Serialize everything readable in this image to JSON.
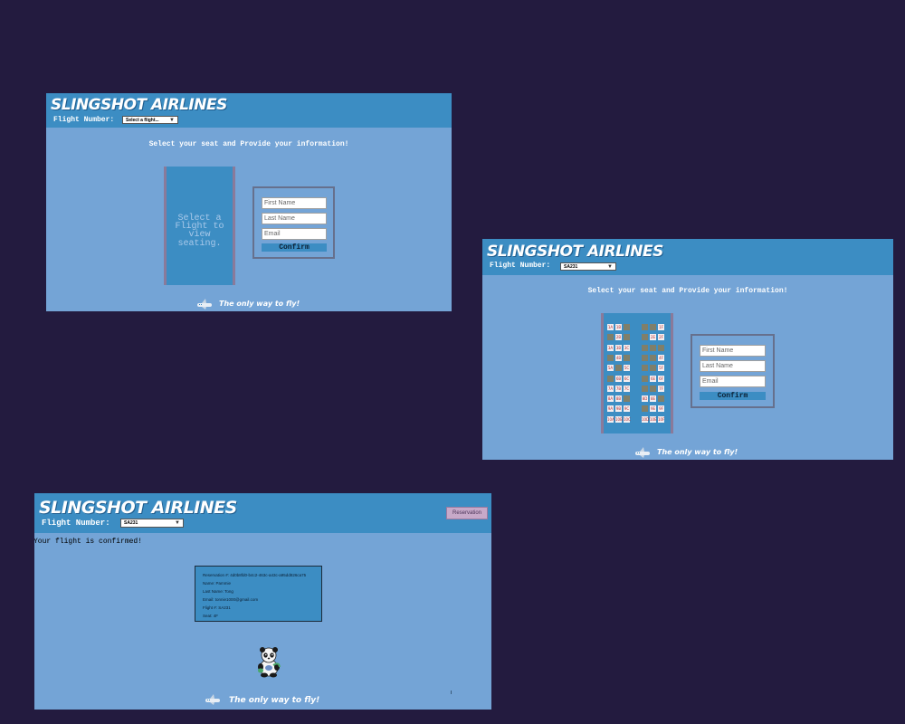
{
  "brand": "SLINGSHOT AIRLINES",
  "flight_label": "Flight Number:",
  "tagline": "The only way to fly!",
  "heading": "Select your seat and Provide your information!",
  "form": {
    "first_name_placeholder": "First Name",
    "last_name_placeholder": "Last Name",
    "email_placeholder": "Email",
    "confirm_label": "Confirm"
  },
  "screen1": {
    "flight_select_value": "Select a flight...",
    "seat_placeholder": [
      "Select a",
      "Flight to",
      "view seating."
    ]
  },
  "screen2": {
    "flight_select_value": "SA231",
    "seats": [
      [
        "1A",
        "1B",
        "1C",
        "1D",
        "1E",
        "1F"
      ],
      [
        "2A",
        "2B",
        "2C",
        "2D",
        "2E",
        "2F"
      ],
      [
        "3A",
        "3B",
        "3C",
        "3D",
        "3E",
        "3F"
      ],
      [
        "4A",
        "4B",
        "4C",
        "4D",
        "4E",
        "4F"
      ],
      [
        "5A",
        "5B",
        "5C",
        "5D",
        "5E",
        "5F"
      ],
      [
        "6A",
        "6B",
        "6C",
        "6D",
        "6E",
        "6F"
      ],
      [
        "7A",
        "7B",
        "7C",
        "7D",
        "7E",
        "7F"
      ],
      [
        "8A",
        "8B",
        "8C",
        "8D",
        "8E",
        "8F"
      ],
      [
        "9A",
        "9B",
        "9C",
        "9D",
        "9E",
        "9F"
      ],
      [
        "10A",
        "10B",
        "10C",
        "10D",
        "10E",
        "10F"
      ]
    ],
    "taken": [
      "1C",
      "1D",
      "1E",
      "2A",
      "2C",
      "2D",
      "3D",
      "3E",
      "3F",
      "4A",
      "4C",
      "4D",
      "4E",
      "5B",
      "5D",
      "5E",
      "6A",
      "6D",
      "7D",
      "7E",
      "8C",
      "8F",
      "9D"
    ]
  },
  "screen3": {
    "flight_select_value": "SA231",
    "reservation_button": "Reservation",
    "confirmed_text": "Your flight is confirmed!",
    "details": [
      "Reservation #: 4d0b8fd0-b4c2-463c-a43c-a95dd826ca75",
      "Name: Pammie",
      "Last Name: Tong",
      "Email: tonnie1000@gmail.com",
      "Flight #: SA231",
      "Seat: 4F"
    ]
  },
  "colors": {
    "background": "#231b3f",
    "panel": "#74a4d6",
    "header": "#3c8dc3",
    "seat_open": "#f4eef0",
    "seat_taken": "#7f7f6a"
  }
}
